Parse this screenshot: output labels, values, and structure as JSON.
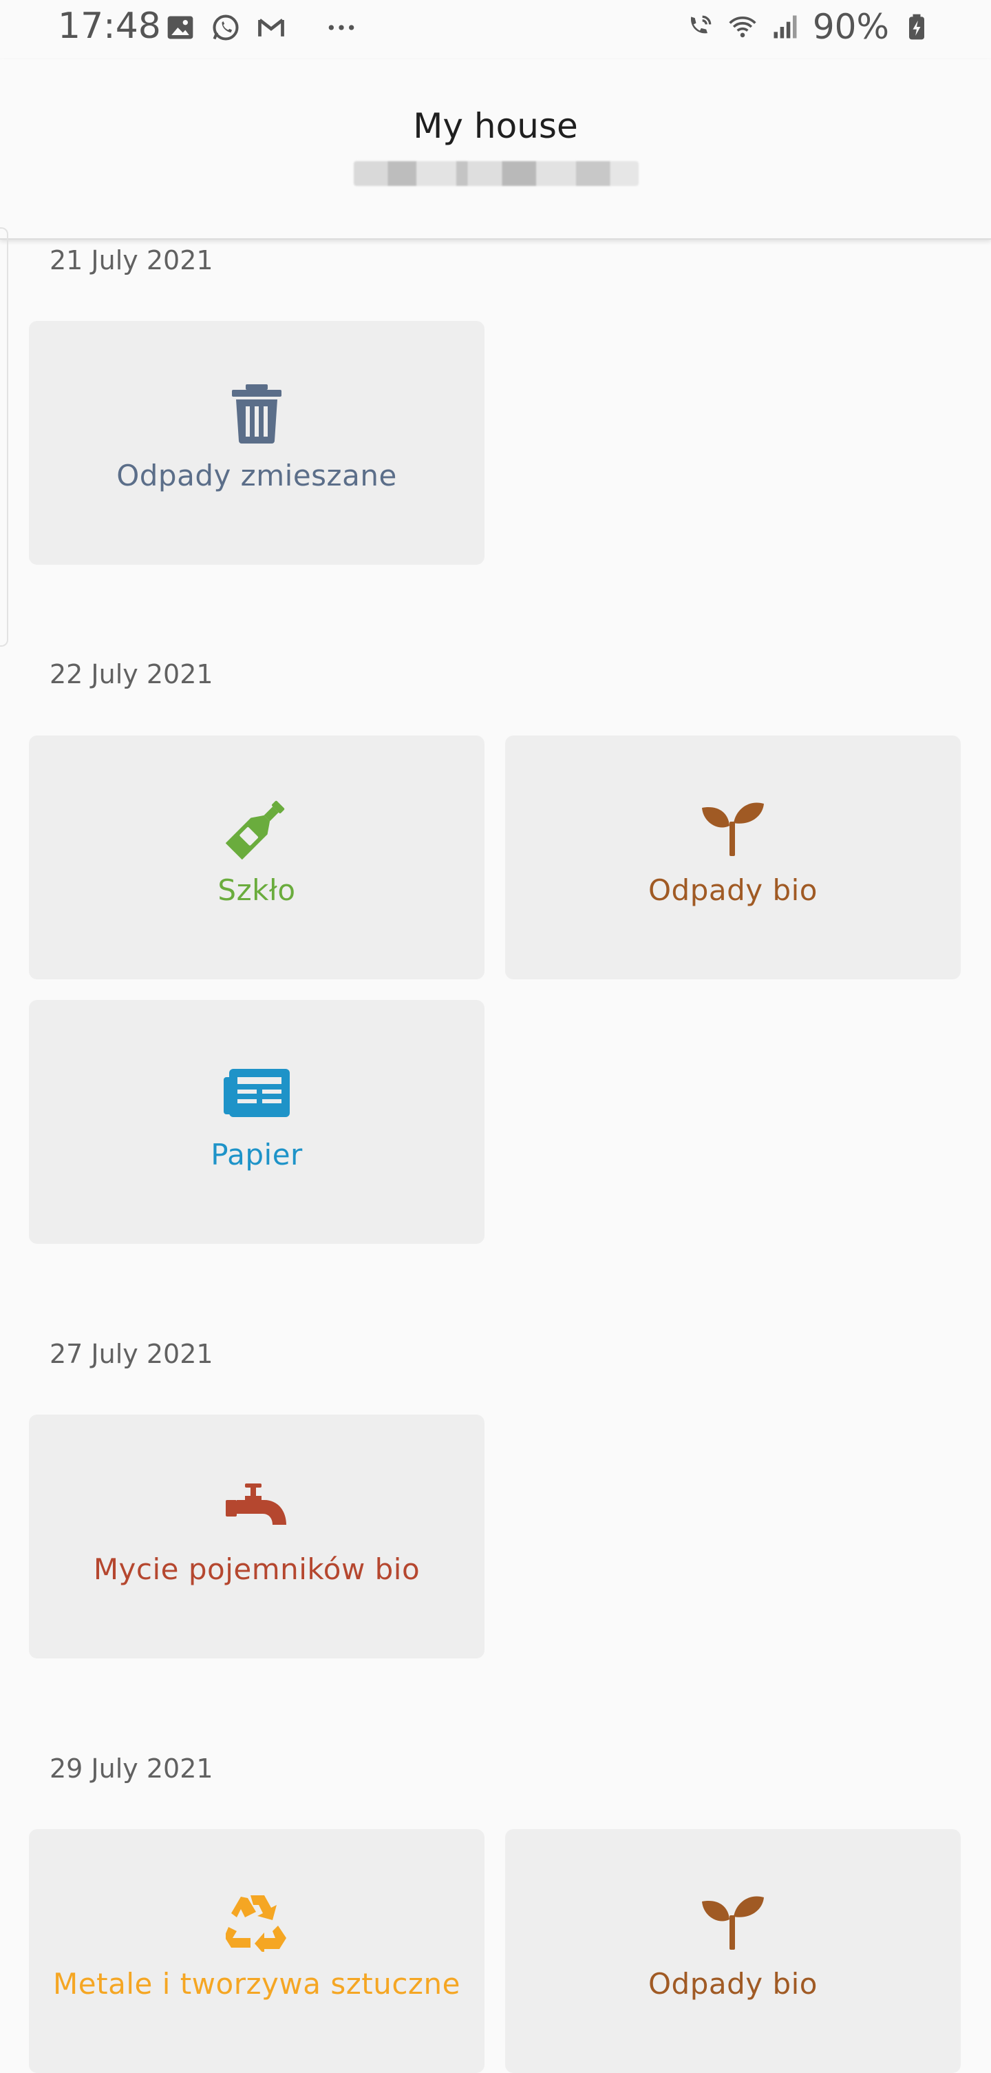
{
  "status_bar": {
    "time": "17:48",
    "battery": "90%",
    "icons_left": [
      "image-icon",
      "whatsapp-icon",
      "gmail-icon",
      "more-icon"
    ],
    "icons_right": [
      "wifi-call-icon",
      "wifi-icon",
      "signal-icon",
      "battery-icon"
    ]
  },
  "header": {
    "title": "My house",
    "subtitle_redacted": true
  },
  "colors": {
    "mixed": "#5b6e89",
    "glass": "#6aac3d",
    "bio": "#a05a24",
    "paper": "#1e93c8",
    "wash": "#b5472f",
    "metal": "#f5a623",
    "card_bg": "#eeeeee"
  },
  "days": [
    {
      "date": "21 July 2021",
      "items": [
        {
          "label": "Odpady zmieszane",
          "icon": "trash-icon",
          "color": "#5b6e89"
        }
      ]
    },
    {
      "date": "22 July 2021",
      "items": [
        {
          "label": "Szkło",
          "icon": "bottle-icon",
          "color": "#6aac3d"
        },
        {
          "label": "Odpady bio",
          "icon": "sprout-icon",
          "color": "#a05a24"
        },
        {
          "label": "Papier",
          "icon": "newspaper-icon",
          "color": "#1e93c8"
        }
      ]
    },
    {
      "date": "27 July 2021",
      "items": [
        {
          "label": "Mycie pojemników bio",
          "icon": "faucet-icon",
          "color": "#b5472f"
        }
      ]
    },
    {
      "date": "29 July 2021",
      "items": [
        {
          "label": "Metale i tworzywa sztuczne",
          "icon": "recycle-icon",
          "color": "#f5a623"
        },
        {
          "label": "Odpady bio",
          "icon": "sprout-icon",
          "color": "#a05a24"
        }
      ]
    }
  ]
}
